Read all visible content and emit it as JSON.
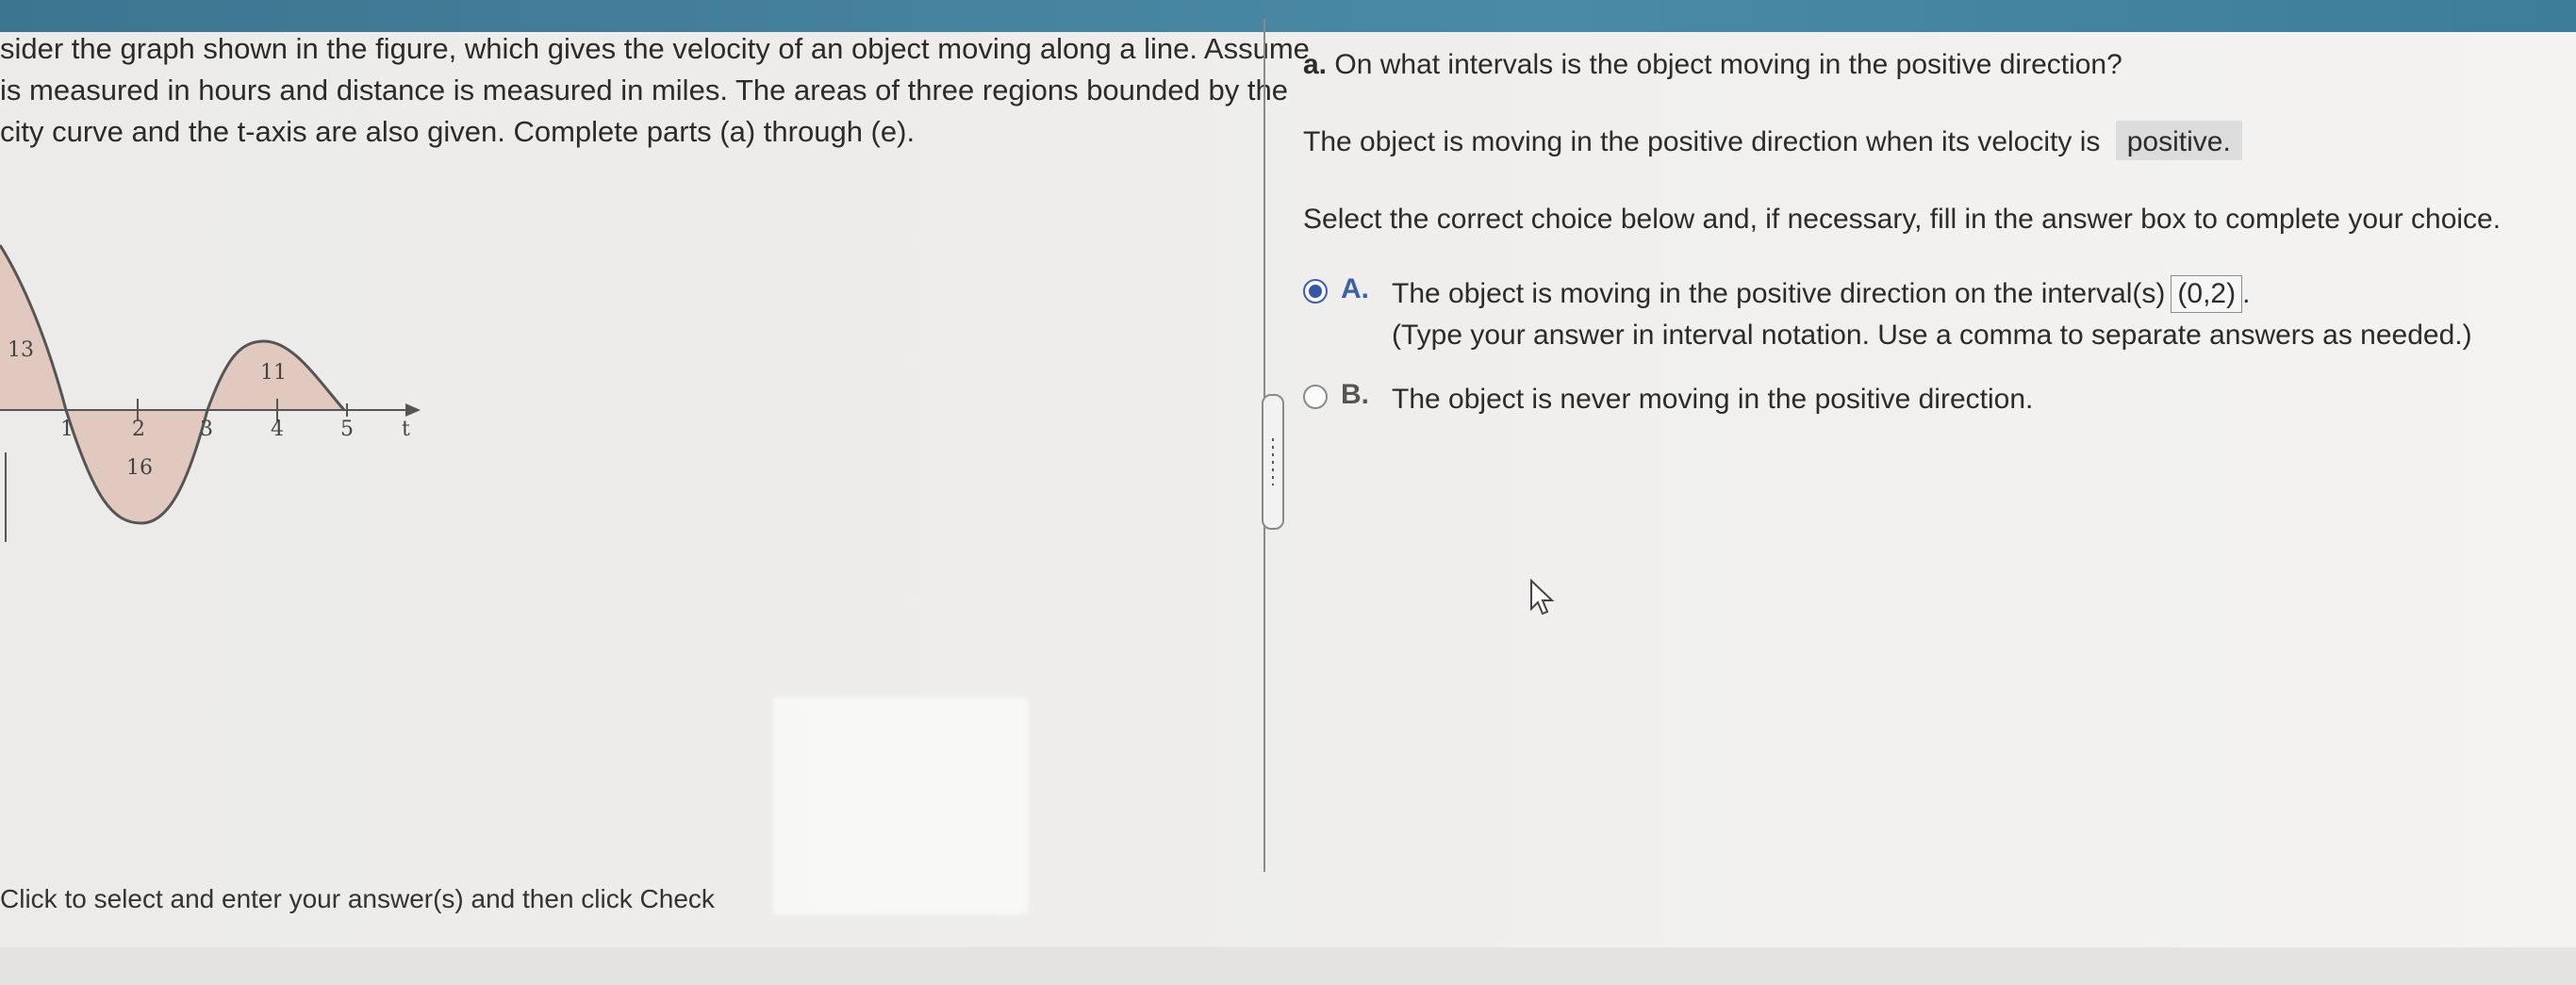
{
  "problem": {
    "line1": "sider the graph shown in the figure, which gives the velocity of an object moving along a line. Assume",
    "line2": "is measured in hours and distance is measured in miles. The areas of three regions bounded by the",
    "line3": "city curve and the t-axis are also given. Complete parts (a) through (e)."
  },
  "graph": {
    "area_labels": [
      "13",
      "16",
      "11"
    ],
    "tick_labels": [
      "1",
      "2",
      "3",
      "4",
      "5"
    ],
    "axis_label": "t"
  },
  "footer_instruction": "Click to select and enter your answer(s) and then click Check",
  "part_a": {
    "label": "a.",
    "question": "On what intervals is the object moving in the positive direction?",
    "statement": "The object is moving in the positive direction when its velocity is",
    "statement_answer": "positive.",
    "select_instruction": "Select the correct choice below and, if necessary, fill in the answer box to complete your choice."
  },
  "choices": {
    "a": {
      "letter": "A.",
      "text": "The object is moving in the positive direction on the interval(s)",
      "answer": "(0,2)",
      "hint": "(Type your answer in interval notation. Use a comma to separate answers as needed.)",
      "selected": true
    },
    "b": {
      "letter": "B.",
      "text": "The object is never moving in the positive direction.",
      "selected": false
    }
  },
  "colors": {
    "accent": "#3557a3",
    "topbar": "#4a8aa6",
    "shaded_region": "#e2c9bf"
  }
}
